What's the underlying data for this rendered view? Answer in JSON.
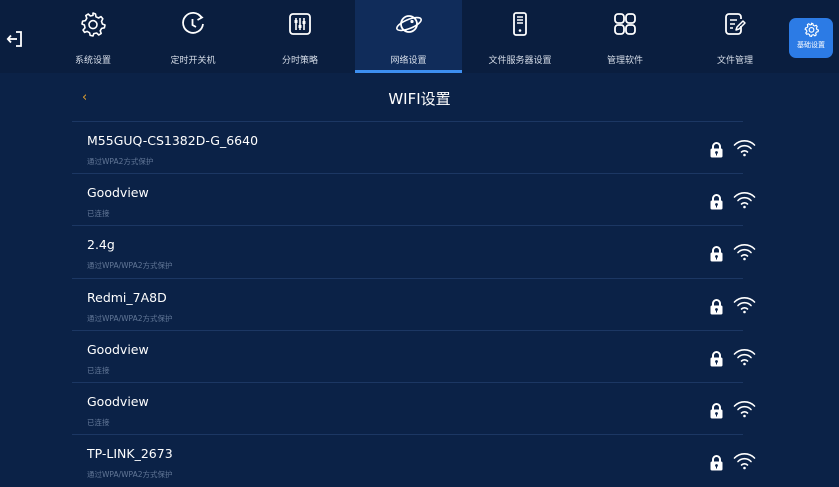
{
  "nav": {
    "tabs": [
      {
        "label": "系统设置",
        "icon": "gear-icon"
      },
      {
        "label": "定时开关机",
        "icon": "clock-refresh-icon"
      },
      {
        "label": "分时策略",
        "icon": "sliders-icon"
      },
      {
        "label": "网络设置",
        "icon": "globe-icon",
        "active": true
      },
      {
        "label": "文件服务器设置",
        "icon": "server-icon"
      },
      {
        "label": "管理软件",
        "icon": "apps-grid-icon"
      },
      {
        "label": "文件管理",
        "icon": "file-edit-icon"
      }
    ],
    "basic": {
      "label": "基础设置",
      "icon": "gear-icon"
    }
  },
  "page": {
    "title": "WIFI设置",
    "back_glyph": "‹"
  },
  "wifi": [
    {
      "ssid": "M55GUQ-CS1382D-G_6640",
      "status": "通过WPA2方式保护"
    },
    {
      "ssid": "Goodview",
      "status": "已连接"
    },
    {
      "ssid": "2.4g",
      "status": "通过WPA/WPA2方式保护"
    },
    {
      "ssid": "Redmi_7A8D",
      "status": "通过WPA/WPA2方式保护"
    },
    {
      "ssid": "Goodview",
      "status": "已连接"
    },
    {
      "ssid": "Goodview",
      "status": "已连接"
    },
    {
      "ssid": "TP-LINK_2673",
      "status": "通过WPA/WPA2方式保护"
    }
  ],
  "colors": {
    "background": "#0b2247",
    "topbar": "#0a1e3f",
    "accent": "#2c7be5",
    "back_arrow": "#e2a12f"
  }
}
